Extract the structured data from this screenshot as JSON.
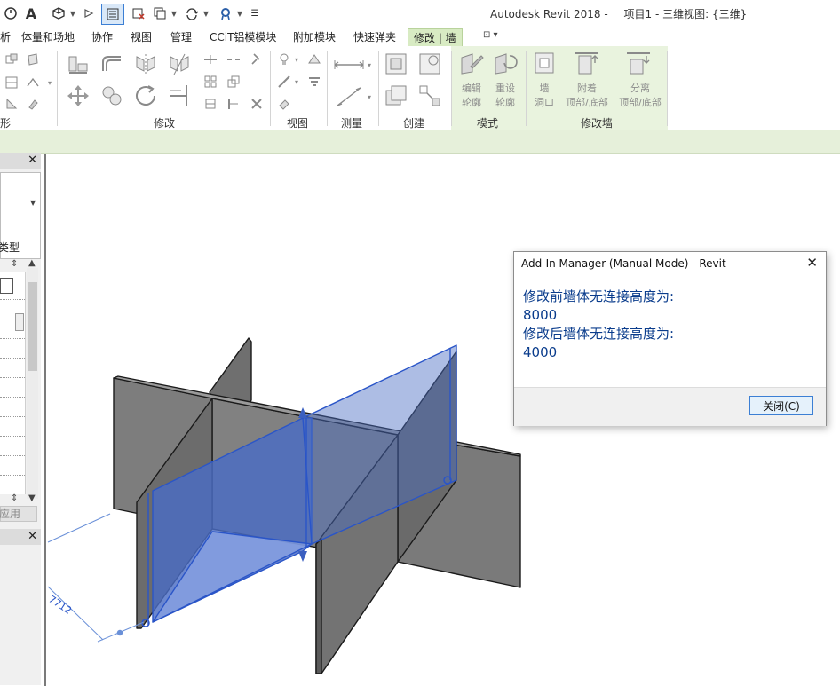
{
  "titlebar": {
    "title": "Autodesk Revit 2018 -",
    "project": "项目1 - 三维视图: {三维}",
    "quick_access": [
      "open-icon",
      "text-icon",
      "3d-view-icon",
      "default-view-icon",
      "thin-lines-icon",
      "close-hidden-icon",
      "switch-windows-icon",
      "sync-icon",
      "cloud-icon",
      "customize-icon"
    ]
  },
  "tabs": {
    "items": [
      "体量和场地",
      "协作",
      "视图",
      "管理",
      "CCiT铝模模块",
      "附加模块",
      "快速弹夹",
      "修改 | 墙"
    ],
    "partial_left": "析",
    "active": "修改 | 墙"
  },
  "ribbon": {
    "groups": {
      "partial_left": "形",
      "modify": "修改",
      "view": "视图",
      "measure": "测量",
      "create": "创建",
      "mode": "模式",
      "modify_wall": "修改墙"
    },
    "mode_buttons": {
      "edit_profile": [
        "编辑",
        "轮廓"
      ],
      "reset_profile": [
        "重设",
        "轮廓"
      ]
    },
    "modify_wall_buttons": {
      "wall_opening": [
        "墙",
        "洞口"
      ],
      "attach": [
        "附着",
        "顶部/底部"
      ],
      "detach": [
        "分离",
        "顶部/底部"
      ]
    }
  },
  "properties": {
    "edit_type": "编辑类型",
    "apply": "应用"
  },
  "viewport": {
    "dimension_text": "7712"
  },
  "dialog": {
    "title": "Add-In Manager (Manual Mode) - Revit",
    "line1": "修改前墙体无连接高度为:",
    "value1": "8000",
    "line2": "修改后墙体无连接高度为:",
    "value2": "4000",
    "close_button": "关闭(C)"
  },
  "colors": {
    "ribbon_active": "#e6f0da",
    "wall_gray": "#808080",
    "wall_selected": "#5a78c8",
    "dialog_text": "#0a3c8c"
  }
}
